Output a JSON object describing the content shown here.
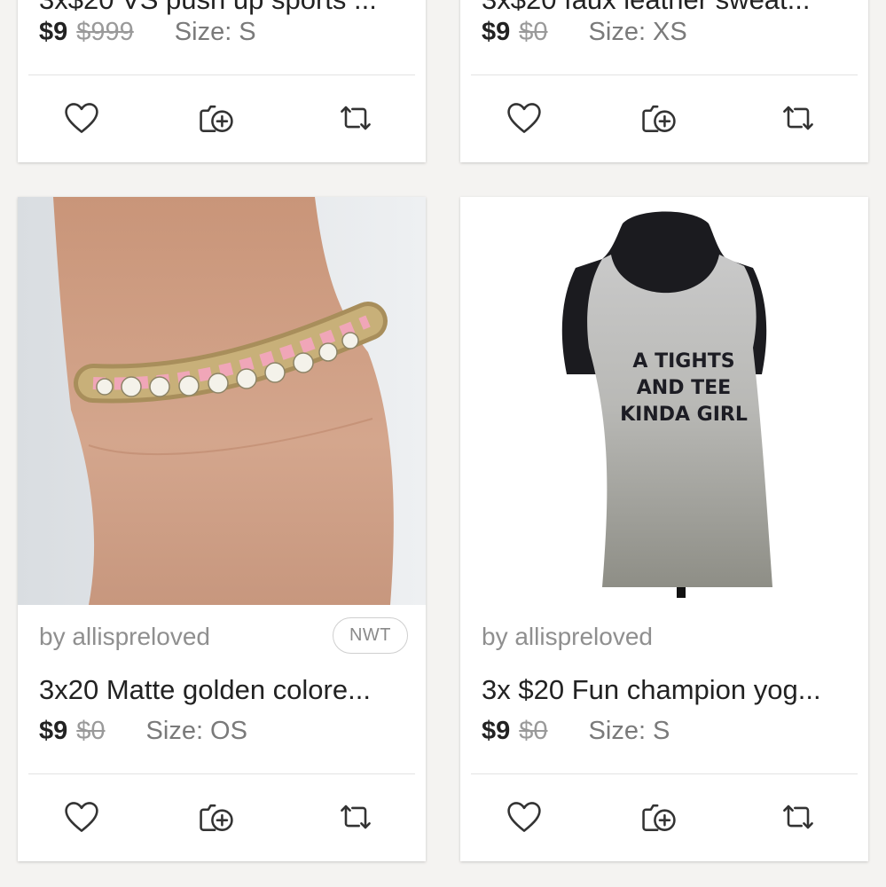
{
  "listings": [
    {
      "title": "3x$20 VS push up sports ...",
      "price": "$9",
      "original_price": "$999",
      "size": "Size: S"
    },
    {
      "title": "3x$20 faux leather sweat...",
      "price": "$9",
      "original_price": "$0",
      "size": "Size: XS"
    },
    {
      "seller": "by allispreloved",
      "badge": "NWT",
      "title": "3x20 Matte golden colore...",
      "price": "$9",
      "original_price": "$0",
      "size": "Size: OS"
    },
    {
      "seller": "by allispreloved",
      "title": "3x $20 Fun champion yog...",
      "price": "$9",
      "original_price": "$0",
      "size": "Size: S",
      "shirt_text": [
        "A TIGHTS",
        "AND TEE",
        "KINDA GIRL"
      ]
    }
  ],
  "icons": {
    "like": "heart-icon",
    "add_to_bundle": "add-to-bundle-icon",
    "share": "share-icon"
  },
  "colors": {
    "background": "#f4f3f1",
    "card": "#ffffff",
    "text": "#222222",
    "muted": "#8f8f8f"
  }
}
